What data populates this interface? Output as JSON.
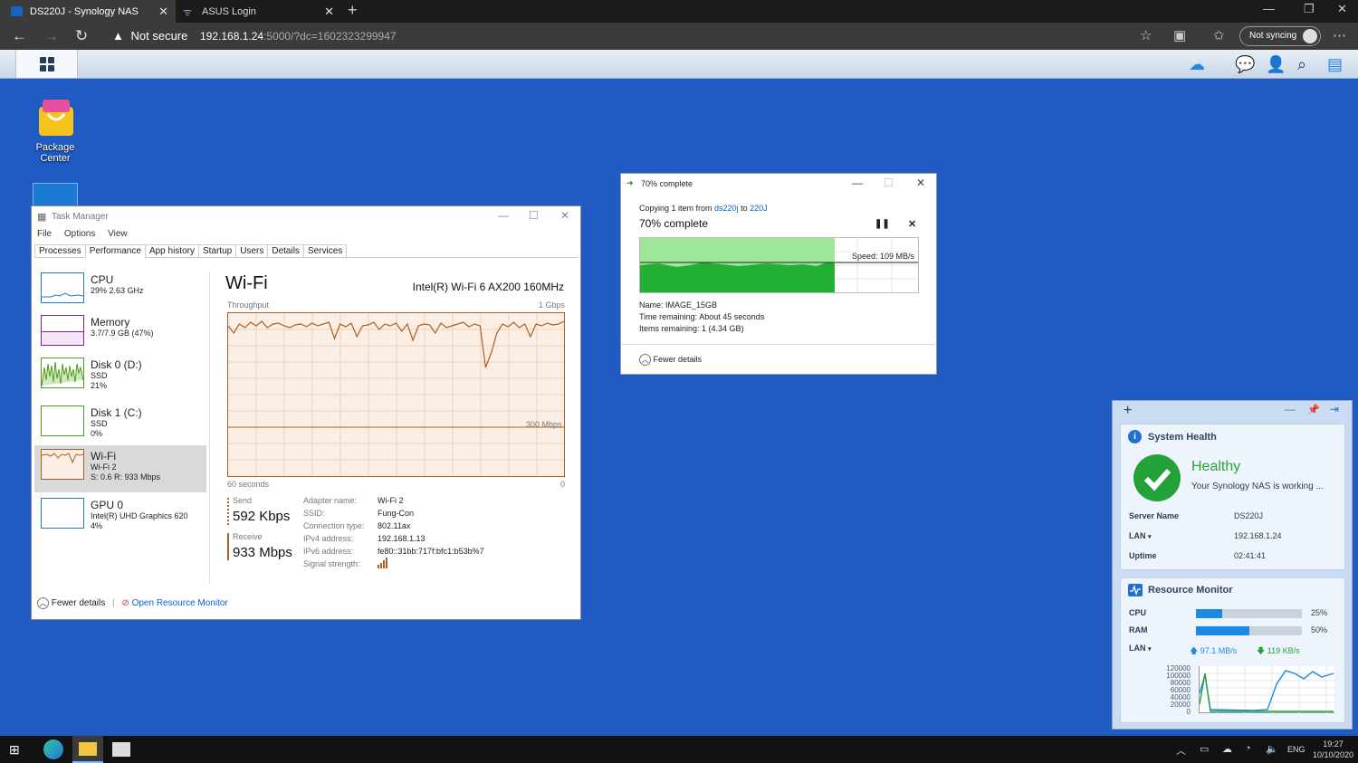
{
  "browser": {
    "tabs": [
      {
        "label": "DS220J - Synology NAS",
        "favicon": "dsm-icon",
        "active": true
      },
      {
        "label": "ASUS Login",
        "favicon": "wireless-icon",
        "active": false
      }
    ],
    "security_label": "Not secure",
    "url_host": "192.168.1.24",
    "url_rest": ":5000/?dc=1602323299947",
    "sync_label": "Not syncing"
  },
  "desktop": {
    "icons": [
      {
        "label_line1": "Package",
        "label_line2": "Center"
      }
    ]
  },
  "task_manager": {
    "title": "Task Manager",
    "menu": [
      "File",
      "Options",
      "View"
    ],
    "tabs": [
      "Processes",
      "Performance",
      "App history",
      "Startup",
      "Users",
      "Details",
      "Services"
    ],
    "active_tab": "Performance",
    "sidebar": [
      {
        "name": "CPU",
        "sub1": "29%  2.63 GHz",
        "sub2": "",
        "sub3": ""
      },
      {
        "name": "Memory",
        "sub1": "3.7/7.9 GB (47%)",
        "sub2": "",
        "sub3": ""
      },
      {
        "name": "Disk 0 (D:)",
        "sub1": "SSD",
        "sub2": "21%",
        "sub3": ""
      },
      {
        "name": "Disk 1 (C:)",
        "sub1": "SSD",
        "sub2": "0%",
        "sub3": ""
      },
      {
        "name": "Wi-Fi",
        "sub1": "Wi-Fi 2",
        "sub2": "S: 0.6  R: 933 Mbps",
        "sub3": ""
      },
      {
        "name": "GPU 0",
        "sub1": "Intel(R) UHD Graphics 620",
        "sub2": "4%",
        "sub3": ""
      }
    ],
    "heading": "Wi-Fi",
    "adapter_title": "Intel(R) Wi-Fi 6 AX200 160MHz",
    "throughput_label": "Throughput",
    "max_label": "1 Gbps",
    "mid_label": "300 Mbps",
    "time_label": "60 seconds",
    "zero_label": "0",
    "send_label": "Send",
    "send_value": "592 Kbps",
    "receive_label": "Receive",
    "receive_value": "933 Mbps",
    "details": [
      {
        "k": "Adapter name:",
        "v": "Wi-Fi 2"
      },
      {
        "k": "SSID:",
        "v": "Fung-Con"
      },
      {
        "k": "Connection type:",
        "v": "802.11ax"
      },
      {
        "k": "IPv4 address:",
        "v": "192.168.1.13"
      },
      {
        "k": "IPv6 address:",
        "v": "fe80::31bb:717f:bfc1:b53b%7"
      },
      {
        "k": "Signal strength:",
        "v": ""
      }
    ],
    "fewer_details": "Fewer details",
    "open_resmon": "Open Resource Monitor"
  },
  "copy_dialog": {
    "title": "70% complete",
    "line_prefix": "Copying 1 item from ",
    "from": "ds220j",
    "to_word": " to ",
    "to": "220J",
    "percent_text": "70% complete",
    "progress": 0.7,
    "speed": "Speed: 109 MB/s",
    "name_line": "Name:  IMAGE_15GB",
    "time_line": "Time remaining:  About 45 seconds",
    "items_line": "Items remaining:  1 (4.34 GB)",
    "fewer_details": "Fewer details"
  },
  "widgets": {
    "health": {
      "title": "System Health",
      "status": "Healthy",
      "message": "Your Synology NAS is working ...",
      "rows": [
        {
          "label": "Server Name",
          "value": "DS220J"
        },
        {
          "label": "LAN",
          "value": "192.168.1.24"
        },
        {
          "label": "Uptime",
          "value": "02:41:41"
        }
      ]
    },
    "resource": {
      "title": "Resource Monitor",
      "cpu_label": "CPU",
      "cpu_pct": 25,
      "cpu_text": "25%",
      "ram_label": "RAM",
      "ram_pct": 50,
      "ram_text": "50%",
      "lan_label": "LAN",
      "upload": "97.1 MB/s",
      "download": "119 KB/s",
      "y_ticks": [
        "120000",
        "100000",
        "80000",
        "60000",
        "40000",
        "20000",
        "0"
      ]
    }
  },
  "taskbar": {
    "lang": "ENG",
    "time": "19:27",
    "date": "10/10/2020"
  },
  "colors": {
    "desktop": "#1f5bc2",
    "wifi_graph": "#b15e1c",
    "copy_green": "#22b033",
    "dsm_accent": "#1e88e5"
  }
}
